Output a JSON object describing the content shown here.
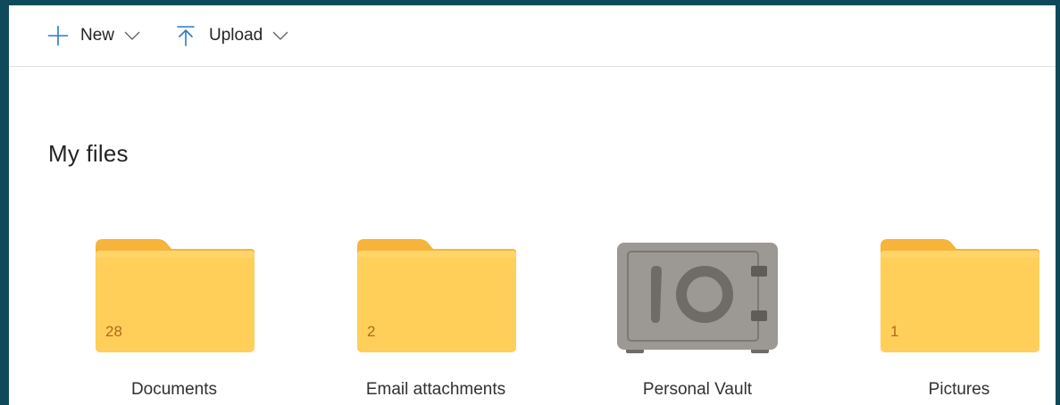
{
  "toolbar": {
    "new_label": "New",
    "new_icon": "plus-icon",
    "upload_label": "Upload",
    "upload_icon": "upload-arrow-icon",
    "accent_color": "#2b79c2"
  },
  "section": {
    "title": "My files"
  },
  "tiles": [
    {
      "name": "Documents",
      "count": "28",
      "type": "folder-icon"
    },
    {
      "name": "Email attachments",
      "count": "2",
      "type": "folder-icon"
    },
    {
      "name": "Personal Vault",
      "count": "",
      "type": "vault-icon"
    },
    {
      "name": "Pictures",
      "count": "1",
      "type": "folder-icon"
    }
  ],
  "colors": {
    "folder_body": "#ffcf5a",
    "folder_back": "#f7b43a",
    "vault_body": "#9c9994"
  }
}
